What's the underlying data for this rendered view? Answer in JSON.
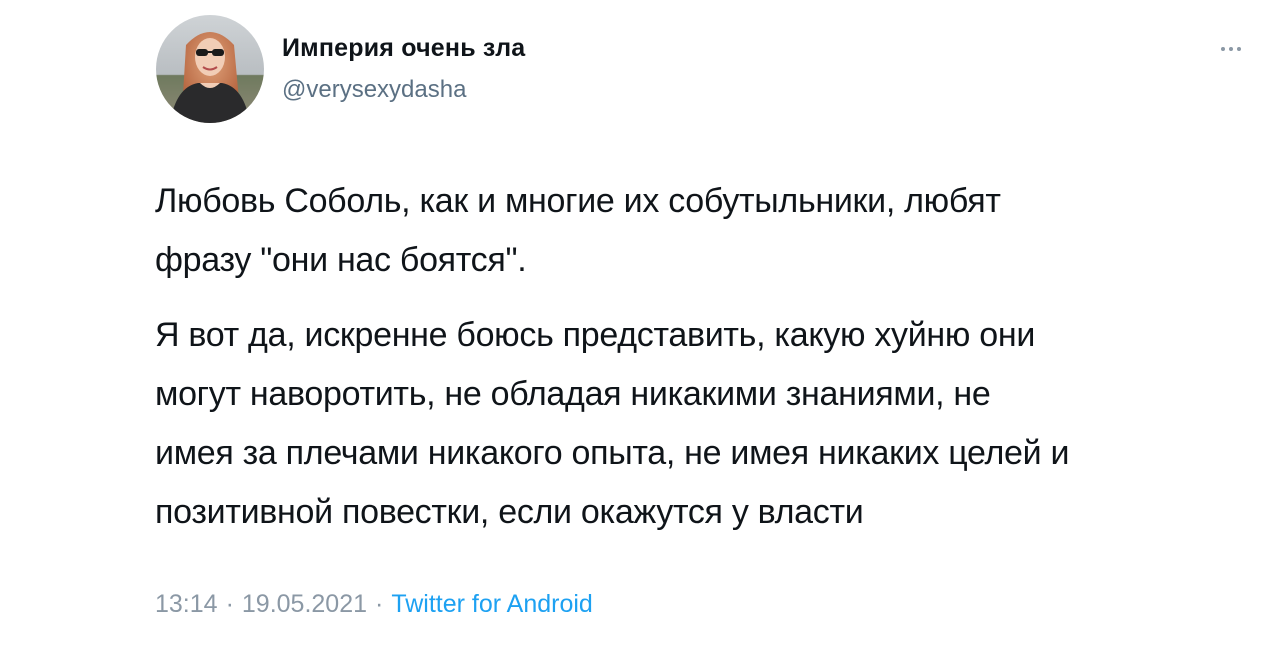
{
  "author": {
    "display_name": "Империя очень зла",
    "handle": "@verysexydasha"
  },
  "tweet": {
    "paragraphs": [
      "Любовь Соболь, как и многие их собутыльники, любят\nфразу \"они нас боятся\".",
      "Я вот да, искренне боюсь представить, какую хуйню они\nмогут наворотить, не обладая никакими знаниями, не\nимея за плечами никакого опыта, не имея никаких целей и\nпозитивной повестки, если окажутся у власти"
    ]
  },
  "meta": {
    "time": "13:14",
    "separator": "·",
    "date": "19.05.2021",
    "source": "Twitter for Android"
  },
  "icons": {
    "more": "more-horizontal-icon"
  },
  "colors": {
    "text": "#0f1419",
    "secondary": "#5b7083",
    "muted": "#8b98a5",
    "accent": "#1da1f2"
  }
}
